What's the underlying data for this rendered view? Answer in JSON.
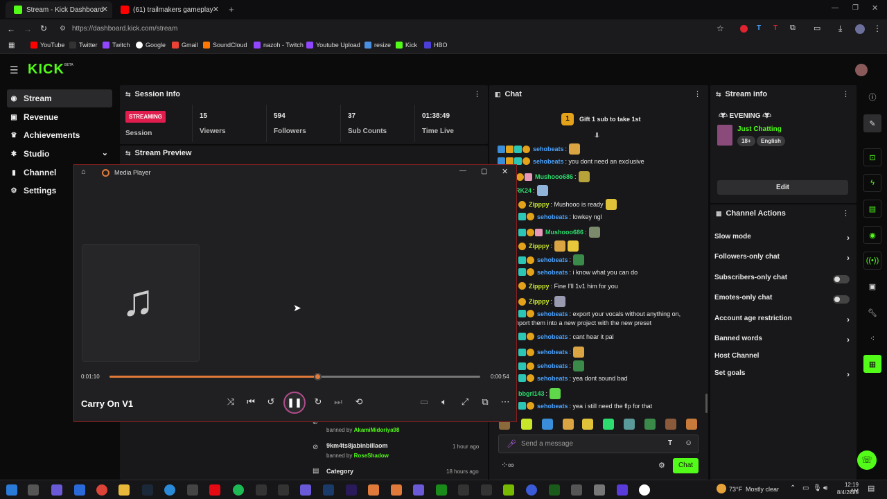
{
  "browser": {
    "tabs": [
      {
        "title": "Stream - Kick Dashboard",
        "active": true
      },
      {
        "title": "(61) trailmakers gameplay - Yo",
        "active": false
      }
    ],
    "url": "https://dashboard.kick.com/stream",
    "bookmarks": [
      "YouTube",
      "Twitter",
      "Twitch",
      "Google",
      "Gmail",
      "SoundCloud",
      "nazoh - Twitch",
      "Youtube Upload",
      "resize",
      "Kick",
      "HBO"
    ]
  },
  "brand": {
    "logo": "KICK",
    "beta": "BETA",
    "accent": "#53fc18"
  },
  "sidebar": {
    "items": [
      {
        "label": "Stream",
        "icon": "stream-icon"
      },
      {
        "label": "Revenue",
        "icon": "revenue-icon"
      },
      {
        "label": "Achievements",
        "icon": "trophy-icon"
      },
      {
        "label": "Studio",
        "icon": "studio-icon"
      },
      {
        "label": "Channel",
        "icon": "channel-icon"
      },
      {
        "label": "Settings",
        "icon": "gear-icon"
      }
    ]
  },
  "session": {
    "title": "Session Info",
    "badge": "STREAMING",
    "badge_label": "Session",
    "stats": [
      {
        "value": "15",
        "label": "Viewers"
      },
      {
        "value": "594",
        "label": "Followers"
      },
      {
        "value": "37",
        "label": "Sub Counts"
      },
      {
        "value": "01:38:49",
        "label": "Time Live"
      }
    ],
    "preview_title": "Stream Preview"
  },
  "media_player": {
    "title": "Media Player",
    "track": "Carry On V1",
    "elapsed": "0:01:10",
    "remaining": "0:00:54",
    "progress": 0.56
  },
  "moderation": {
    "items": [
      {
        "user": "9km4ts8jabinbillaom",
        "by_prefix": "banned by",
        "by": "RoseShadow",
        "time": "1 hour ago"
      },
      {
        "user": "Category",
        "by_prefix": "",
        "by": "",
        "time": "18 hours ago"
      }
    ],
    "partial_by_prefix": "banned by",
    "partial_by": "AkamiMidoriya98"
  },
  "chat": {
    "title": "Chat",
    "gift_text": "Gift 1 sub to take 1st",
    "gift_count": "1",
    "messages": [
      {
        "user": "sehobeats",
        "color": "#4aa3ff",
        "text": ""
      },
      {
        "user": "sehobeats",
        "color": "#4aa3ff",
        "text": "you dont need an exclusive"
      },
      {
        "user": "Mushooo686",
        "color": "#2ddc6e",
        "text": ""
      },
      {
        "user": "RK24",
        "color": "#2ddc6e",
        "text": ""
      },
      {
        "user": "Zipppy",
        "color": "#c8e62a",
        "text": "Mushooo is ready"
      },
      {
        "user": "sehobeats",
        "color": "#4aa3ff",
        "text": "lowkey ngl"
      },
      {
        "user": "Mushooo686",
        "color": "#2ddc6e",
        "text": ""
      },
      {
        "user": "Zipppy",
        "color": "#c8e62a",
        "text": ""
      },
      {
        "user": "sehobeats",
        "color": "#4aa3ff",
        "text": ""
      },
      {
        "user": "sehobeats",
        "color": "#4aa3ff",
        "text": "i know what you can do"
      },
      {
        "user": "Zipppy",
        "color": "#c8e62a",
        "text": "Fine I'll 1v1 him for you"
      },
      {
        "user": "Zipppy",
        "color": "#c8e62a",
        "text": ""
      },
      {
        "user": "sehobeats",
        "color": "#4aa3ff",
        "text": "export your vocals without anything on,"
      },
      {
        "user": "",
        "color": "#e8e8e8",
        "text": "nport them into a new project with the new preset"
      },
      {
        "user": "sehobeats",
        "color": "#4aa3ff",
        "text": "cant hear it pal"
      },
      {
        "user": "sehobeats",
        "color": "#4aa3ff",
        "text": ""
      },
      {
        "user": "sehobeats",
        "color": "#4aa3ff",
        "text": ""
      },
      {
        "user": "sehobeats",
        "color": "#4aa3ff",
        "text": "yea dont sound bad"
      },
      {
        "user": "bbgrl143",
        "color": "#2ddc6e",
        "text": ""
      },
      {
        "user": "sehobeats",
        "color": "#4aa3ff",
        "text": "yea i still need the flp for that"
      }
    ],
    "input_placeholder": "Send a message",
    "send_label": "Chat"
  },
  "stream_info": {
    "title": "Stream info",
    "stream_title": "EVENING",
    "category": "Just Chatting",
    "tags": [
      "18+",
      "English"
    ],
    "edit_label": "Edit"
  },
  "channel_actions": {
    "title": "Channel Actions",
    "items": [
      {
        "label": "Slow mode",
        "control": "chevron"
      },
      {
        "label": "Followers-only chat",
        "control": "chevron"
      },
      {
        "label": "Subscribers-only chat",
        "control": "toggle"
      },
      {
        "label": "Emotes-only chat",
        "control": "toggle"
      },
      {
        "label": "Account age restriction",
        "control": "chevron"
      },
      {
        "label": "Banned words",
        "control": "chevron"
      },
      {
        "label": "Host Channel",
        "control": "none"
      },
      {
        "label": "Set goals",
        "control": "chevron"
      }
    ]
  },
  "taskbar": {
    "weather": "73°F",
    "weather_text": "Mostly clear",
    "time": "12:19 AM",
    "date": "8/4/2025"
  }
}
